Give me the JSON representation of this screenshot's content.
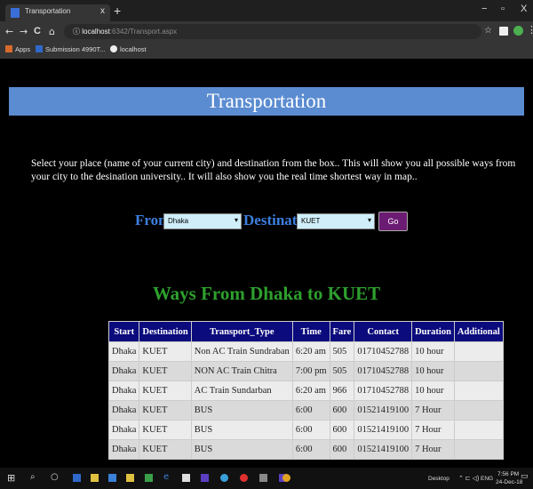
{
  "browser": {
    "tab_title": "Transportation",
    "tab_close": "x",
    "new_tab": "+",
    "window_controls": {
      "minimize": "−",
      "maximize": "▫",
      "close": "X"
    },
    "nav": {
      "back": "←",
      "forward": "→",
      "reload": "C",
      "home": "⌂"
    },
    "url_host": "localhost",
    "url_path": ":6342/Transport.aspx",
    "menu": "⋮",
    "bookmarks": [
      {
        "label": "Apps",
        "color": "#d66b2b"
      },
      {
        "label": "Submission 4990T...",
        "color": "#2f68c9"
      },
      {
        "label": "localhost",
        "color": "#eeeeee"
      }
    ]
  },
  "page": {
    "title": "Transportation",
    "intro": "Select your place (name of your current city) and destination from the box.. This will show you all possible ways from your city to the desination university.. It will also show you the real time shortest way in map..",
    "from_label": "From",
    "from_value": "Dhaka",
    "destination_label": "Destination",
    "destination_value": "KUET",
    "go_label": "Go",
    "ways_title": "Ways From Dhaka to KUET",
    "table": {
      "headers": [
        "Start",
        "Destination",
        "Transport_Type",
        "Time",
        "Fare",
        "Contact",
        "Duration",
        "Additional"
      ],
      "rows": [
        [
          "Dhaka",
          "KUET",
          "Non AC Train Sundraban",
          "6:20 am",
          "505",
          "01710452788",
          "10 hour",
          ""
        ],
        [
          "Dhaka",
          "KUET",
          "NON AC Train Chitra",
          "7:00 pm",
          "505",
          "01710452788",
          "10 hour",
          ""
        ],
        [
          "Dhaka",
          "KUET",
          "AC Train Sundarban",
          "6:20 am",
          "966",
          "01710452788",
          "10 hour",
          ""
        ],
        [
          "Dhaka",
          "KUET",
          "BUS",
          "6:00",
          "600",
          "01521419100",
          "7 Hour",
          ""
        ],
        [
          "Dhaka",
          "KUET",
          "BUS",
          "6:00",
          "600",
          "01521419100",
          "7 Hour",
          ""
        ],
        [
          "Dhaka",
          "KUET",
          "BUS",
          "6:00",
          "600",
          "01521419100",
          "7 Hour",
          ""
        ]
      ]
    }
  },
  "taskbar": {
    "desktop_label": "Desktop",
    "language": "ENG",
    "time": "7:56 PM",
    "date": "24-Dec-18",
    "start_icon": "windows-icon",
    "icon_colors": [
      "#2f68c9",
      "#e0c040",
      "#3a7fd8",
      "#e0c040",
      "#3aa04a",
      "#3a7fd8",
      "#ddd",
      "#5b3fc0",
      "#3a9fd8",
      "#e03030",
      "#888",
      "#5b3fc0",
      "#e0a020"
    ]
  }
}
